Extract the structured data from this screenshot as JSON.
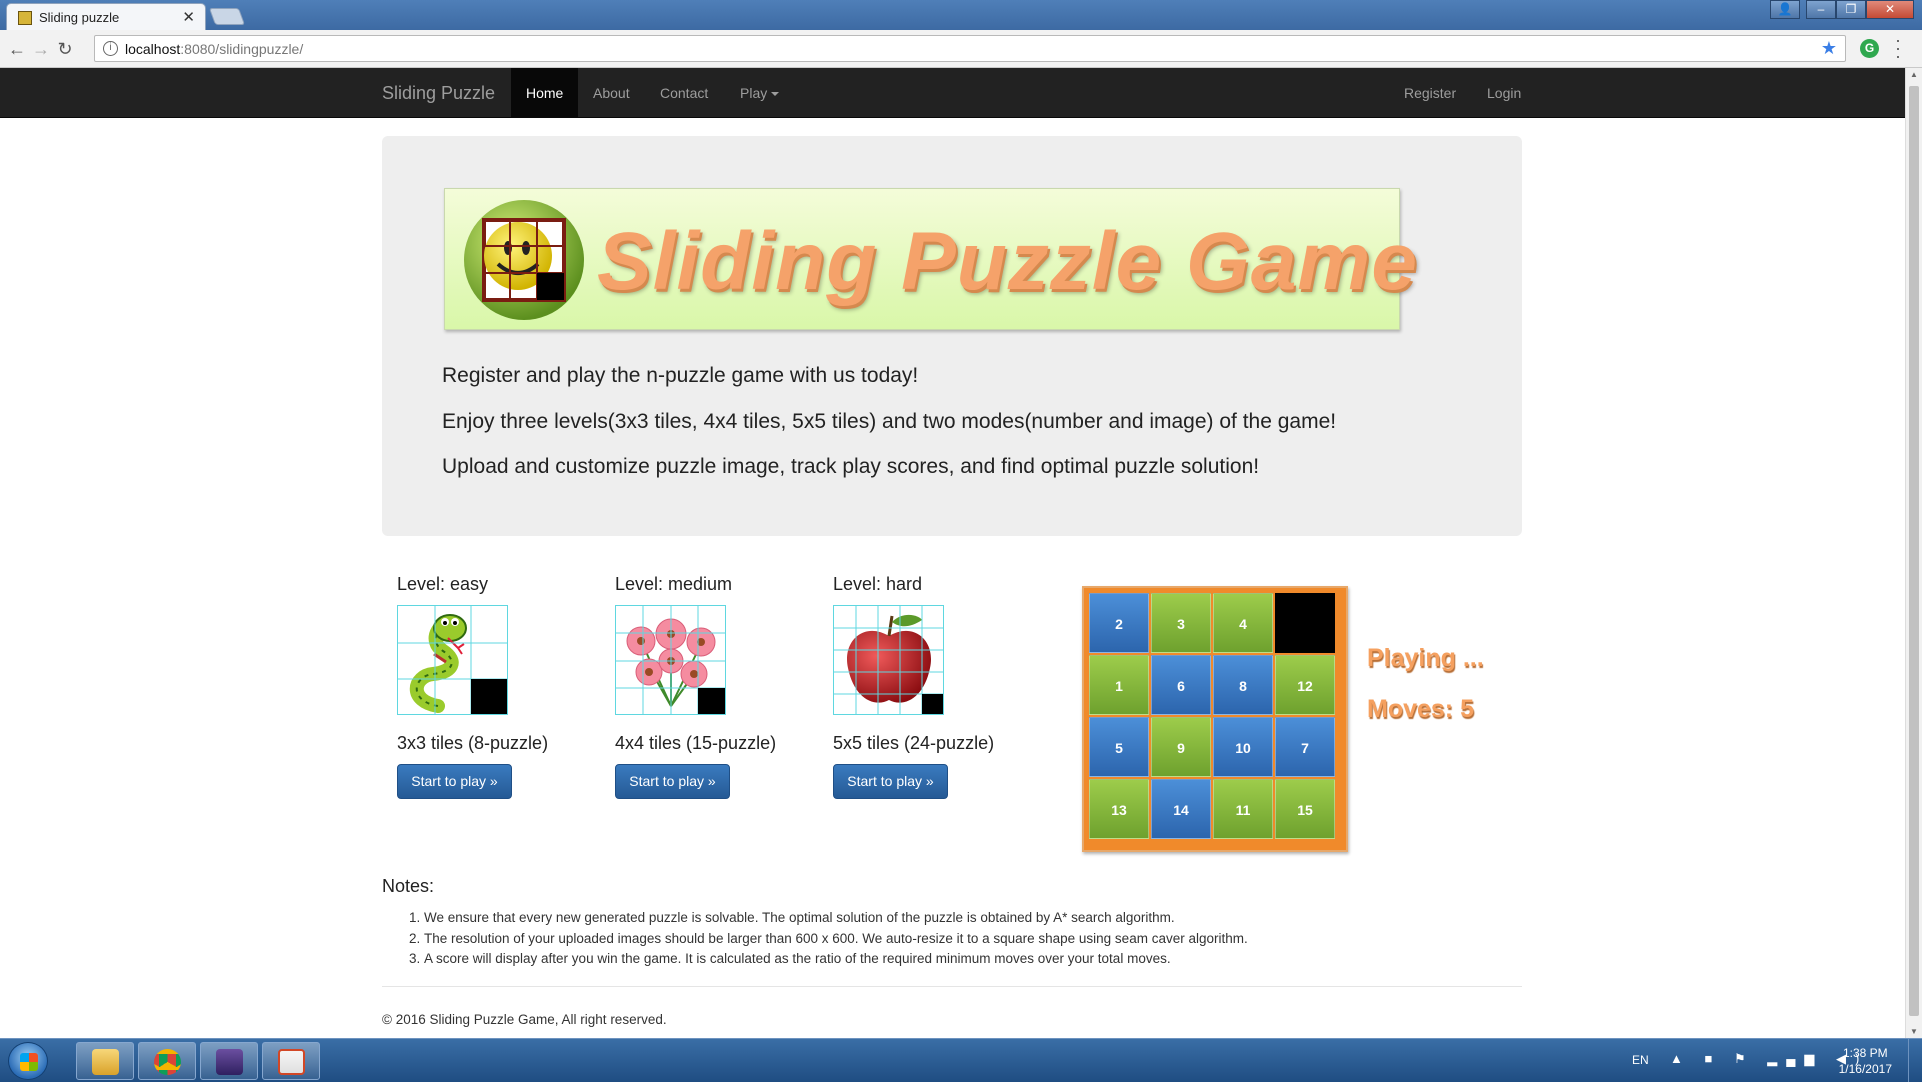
{
  "browser": {
    "tab_title": "Sliding puzzle",
    "url_host": "localhost",
    "url_rest": ":8080/slidingpuzzle/"
  },
  "navbar": {
    "brand": "Sliding Puzzle",
    "items": [
      "Home",
      "About",
      "Contact",
      "Play"
    ],
    "right_items": [
      "Register",
      "Login"
    ]
  },
  "jumbotron": {
    "banner_title": "Sliding Puzzle Game",
    "lines": [
      "Register and play the n-puzzle game with us today!",
      "Enjoy three levels(3x3 tiles, 4x4 tiles, 5x5 tiles) and two modes(number and image) of the game!",
      "Upload and customize puzzle image, track play scores, and find optimal puzzle solution!"
    ]
  },
  "levels": [
    {
      "label": "Level: easy",
      "tiles": "3x3 tiles (8-puzzle)",
      "button": "Start to play »",
      "image": "snake-icon"
    },
    {
      "label": "Level: medium",
      "tiles": "4x4 tiles (15-puzzle)",
      "button": "Start to play »",
      "image": "flowers-icon"
    },
    {
      "label": "Level: hard",
      "tiles": "5x5 tiles (24-puzzle)",
      "button": "Start to play »",
      "image": "apple-icon"
    }
  ],
  "demo_board": {
    "cells": [
      {
        "n": "2",
        "c": "blue"
      },
      {
        "n": "3",
        "c": "green"
      },
      {
        "n": "4",
        "c": "green"
      },
      {
        "n": "",
        "c": "empty"
      },
      {
        "n": "1",
        "c": "green"
      },
      {
        "n": "6",
        "c": "blue"
      },
      {
        "n": "8",
        "c": "blue"
      },
      {
        "n": "12",
        "c": "green"
      },
      {
        "n": "5",
        "c": "blue"
      },
      {
        "n": "9",
        "c": "green"
      },
      {
        "n": "10",
        "c": "blue"
      },
      {
        "n": "7",
        "c": "blue"
      },
      {
        "n": "13",
        "c": "green"
      },
      {
        "n": "14",
        "c": "blue"
      },
      {
        "n": "11",
        "c": "green"
      },
      {
        "n": "15",
        "c": "green"
      }
    ],
    "status": "Playing ...",
    "moves": "Moves:  5"
  },
  "notes": {
    "heading": "Notes:",
    "items": [
      "We ensure that every new generated puzzle is solvable. The optimal solution of the puzzle is obtained by A* search algorithm.",
      "The resolution of your uploaded images should be larger than 600 x 600. We auto-resize it to a square shape using seam caver algorithm.",
      "A score will display after you win the game. It is calculated as the ratio of the required minimum moves over your total moves."
    ]
  },
  "footer": "© 2016 Sliding Puzzle Game, All right reserved.",
  "taskbar": {
    "lang": "EN",
    "time": "1:38 PM",
    "date": "1/16/2017"
  },
  "colors": {
    "navbar_bg": "#222222",
    "button_blue": "#2c64a3",
    "tile_blue": "#3a78c2",
    "tile_green": "#86b83c",
    "board_orange": "#f08a2b",
    "title_orange": "#f5a26a"
  }
}
